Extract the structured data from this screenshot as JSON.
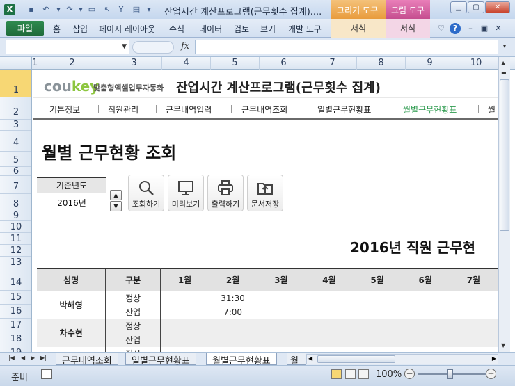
{
  "window": {
    "title": "잔업시간 계산프로그램(근무횟수 집계)....",
    "context_tabs": [
      "그리기 도구",
      "그림 도구"
    ],
    "context_subtabs": [
      "서식",
      "서식"
    ]
  },
  "ribbon": {
    "file_tab": "파일",
    "tabs": [
      "홈",
      "삽입",
      "페이지 레이아웃",
      "수식",
      "데이터",
      "검토",
      "보기",
      "개발 도구"
    ]
  },
  "formula_bar": {
    "name_box": "",
    "fx": "fx",
    "formula": ""
  },
  "columns": [
    "1",
    "2",
    "3",
    "4",
    "5",
    "6",
    "7",
    "8",
    "9",
    "10"
  ],
  "rows": [
    "1",
    "2",
    "3",
    "4",
    "5",
    "6",
    "7",
    "8",
    "9",
    "10",
    "11",
    "12",
    "13",
    "14",
    "15",
    "16",
    "17",
    "18",
    "19"
  ],
  "sheet": {
    "logo_main": "cou",
    "logo_key": "key",
    "logo_sub": "맞춤형엑셀업무자동화",
    "program_title": "잔업시간 계산프로그램(근무횟수 집계)",
    "nav": [
      "기본정보",
      "직원관리",
      "근무내역입력",
      "근무내역조회",
      "일별근무현황표",
      "월별근무현황표",
      "월"
    ],
    "page_title": "월별 근무현황 조회",
    "year_label": "기준년도",
    "year_value": "2016년",
    "buttons": [
      "조회하기",
      "미리보기",
      "출력하기",
      "문서저장"
    ],
    "report_title": "2016년 직원 근무현",
    "table": {
      "headers": [
        "성명",
        "구분",
        "1월",
        "2월",
        "3월",
        "4월",
        "5월",
        "6월",
        "7월"
      ],
      "employees": [
        {
          "name": "박해영",
          "rows": [
            [
              "정상",
              "",
              "31:30",
              "",
              "",
              "",
              "",
              ""
            ],
            [
              "잔업",
              "",
              "7:00",
              "",
              "",
              "",
              "",
              ""
            ]
          ]
        },
        {
          "name": "차수현",
          "rows": [
            [
              "정상",
              "",
              "",
              "",
              "",
              "",
              "",
              ""
            ],
            [
              "잔업",
              "",
              "",
              "",
              "",
              "",
              "",
              ""
            ]
          ]
        },
        {
          "name": "",
          "rows": [
            [
              "정상",
              "",
              "",
              "",
              "",
              "",
              "",
              ""
            ]
          ]
        }
      ]
    }
  },
  "sheet_tabs": [
    "근무내역조회",
    "일별근무현황표",
    "월별근무현황표",
    "월"
  ],
  "active_sheet_tab": "월별근무현황표",
  "status": {
    "text": "준비",
    "zoom": "100%"
  }
}
